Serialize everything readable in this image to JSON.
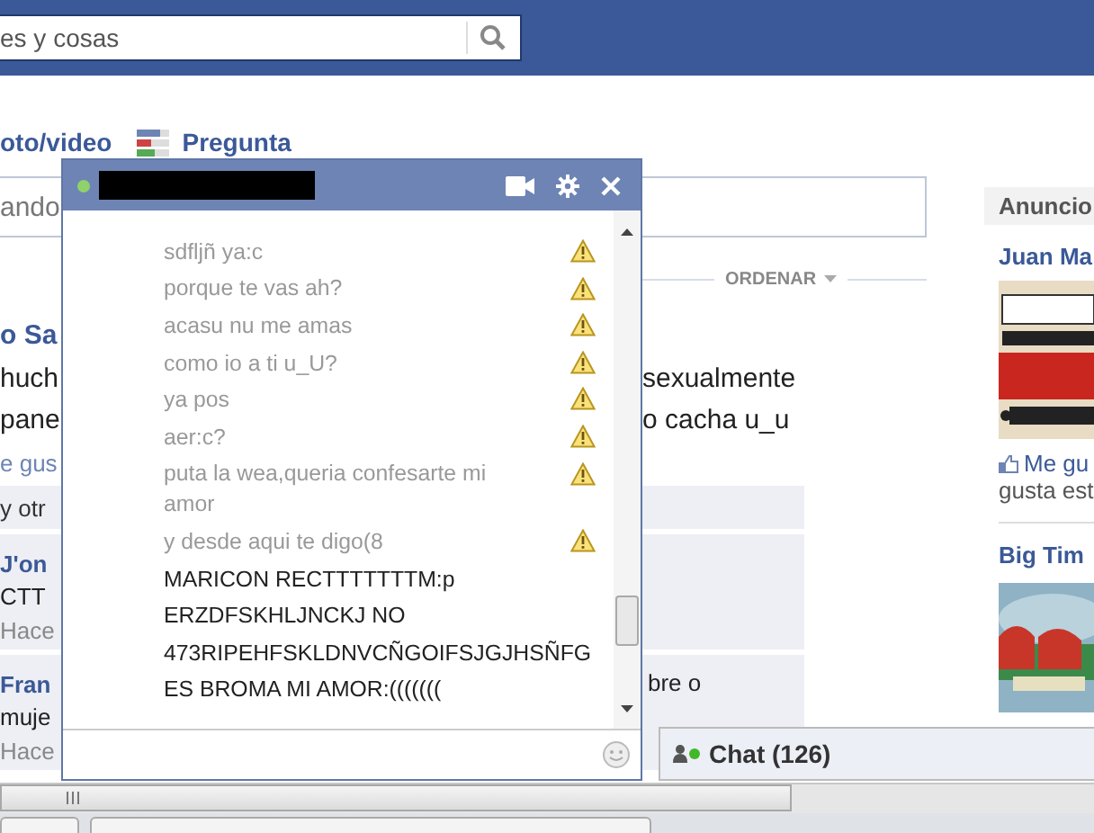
{
  "top_bar": {
    "search": {
      "value": "es y cosas"
    }
  },
  "composer": {
    "actions": [
      {
        "label": "oto/video"
      },
      {
        "label": "Pregunta",
        "kind": "question"
      }
    ],
    "placeholder": "ando"
  },
  "sort": {
    "label": "ORDENAR"
  },
  "post": {
    "author": "o Sa",
    "lines": [
      {
        "left": "huch",
        "right": "sexualmente"
      },
      {
        "left": "pane",
        "right": "o cacha u_u"
      }
    ],
    "like_link": "e gus",
    "likes": "y otr",
    "comments": [
      {
        "author": "J'on",
        "text": "CTT",
        "time": "Hace"
      },
      {
        "author": "Fran",
        "text": "muje",
        "time": "Hace",
        "right": "bre o"
      }
    ]
  },
  "ads": {
    "header": "Anuncio",
    "items": [
      {
        "title": "Juan Ma",
        "like": "Me gu",
        "note": "gusta est",
        "kind": "picture"
      },
      {
        "title": "Big Tim",
        "kind": "picture"
      }
    ]
  },
  "chat": {
    "online": true,
    "messages": [
      {
        "text": "sdfljñ ya:c",
        "failed": true
      },
      {
        "text": "porque te vas ah?",
        "failed": true
      },
      {
        "text": "acasu nu me amas",
        "failed": true
      },
      {
        "text": "como io a ti u_U?",
        "failed": true
      },
      {
        "text": "ya pos",
        "failed": true
      },
      {
        "text": "aer:c?",
        "failed": true
      },
      {
        "text": "puta la wea,queria confesarte mi amor",
        "failed": true
      },
      {
        "text": "y desde aqui te digo(8",
        "failed": true
      },
      {
        "text": "MARICON RECTTTTTTTM:p",
        "failed": false
      },
      {
        "text": "ERZDFSKHLJNCKJ NO",
        "failed": false
      },
      {
        "text": "473RIPEHFSKLDNVCÑGOIFSJGJHSÑFG",
        "failed": false
      },
      {
        "text": "ES BROMA MI AMOR:(((((((",
        "failed": false
      }
    ]
  },
  "chat_bar": {
    "label": "Chat (126)"
  }
}
